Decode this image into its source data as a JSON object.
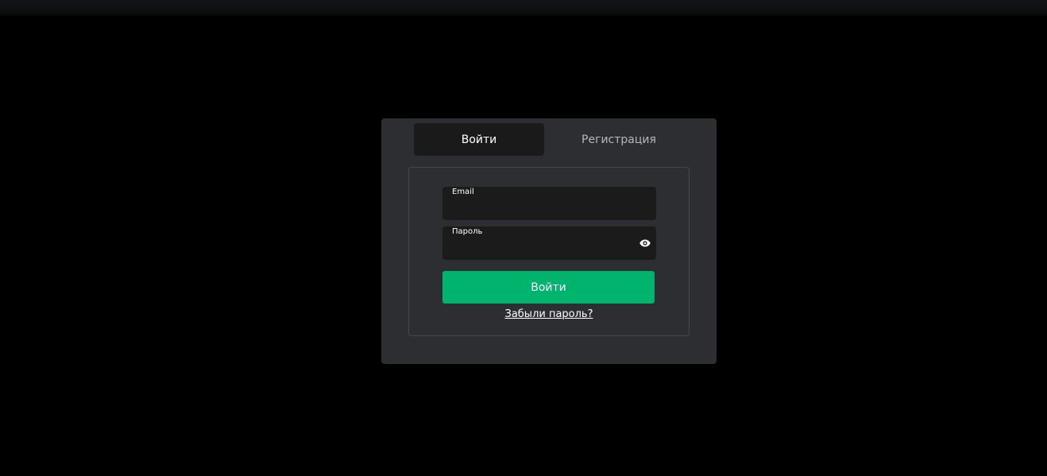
{
  "tabs": [
    {
      "label": "Войти",
      "active": true
    },
    {
      "label": "Регистрация",
      "active": false
    }
  ],
  "form": {
    "email_label": "Email",
    "email_value": "",
    "password_label": "Пароль",
    "password_value": "",
    "submit_label": "Войти",
    "forgot_label": "Забыли пароль?"
  },
  "icons": {
    "password_toggle": "eye-icon"
  },
  "colors": {
    "accent": "#00b46e",
    "panel": "#2d2e32",
    "field": "#1b1b1c",
    "background": "#000000"
  }
}
